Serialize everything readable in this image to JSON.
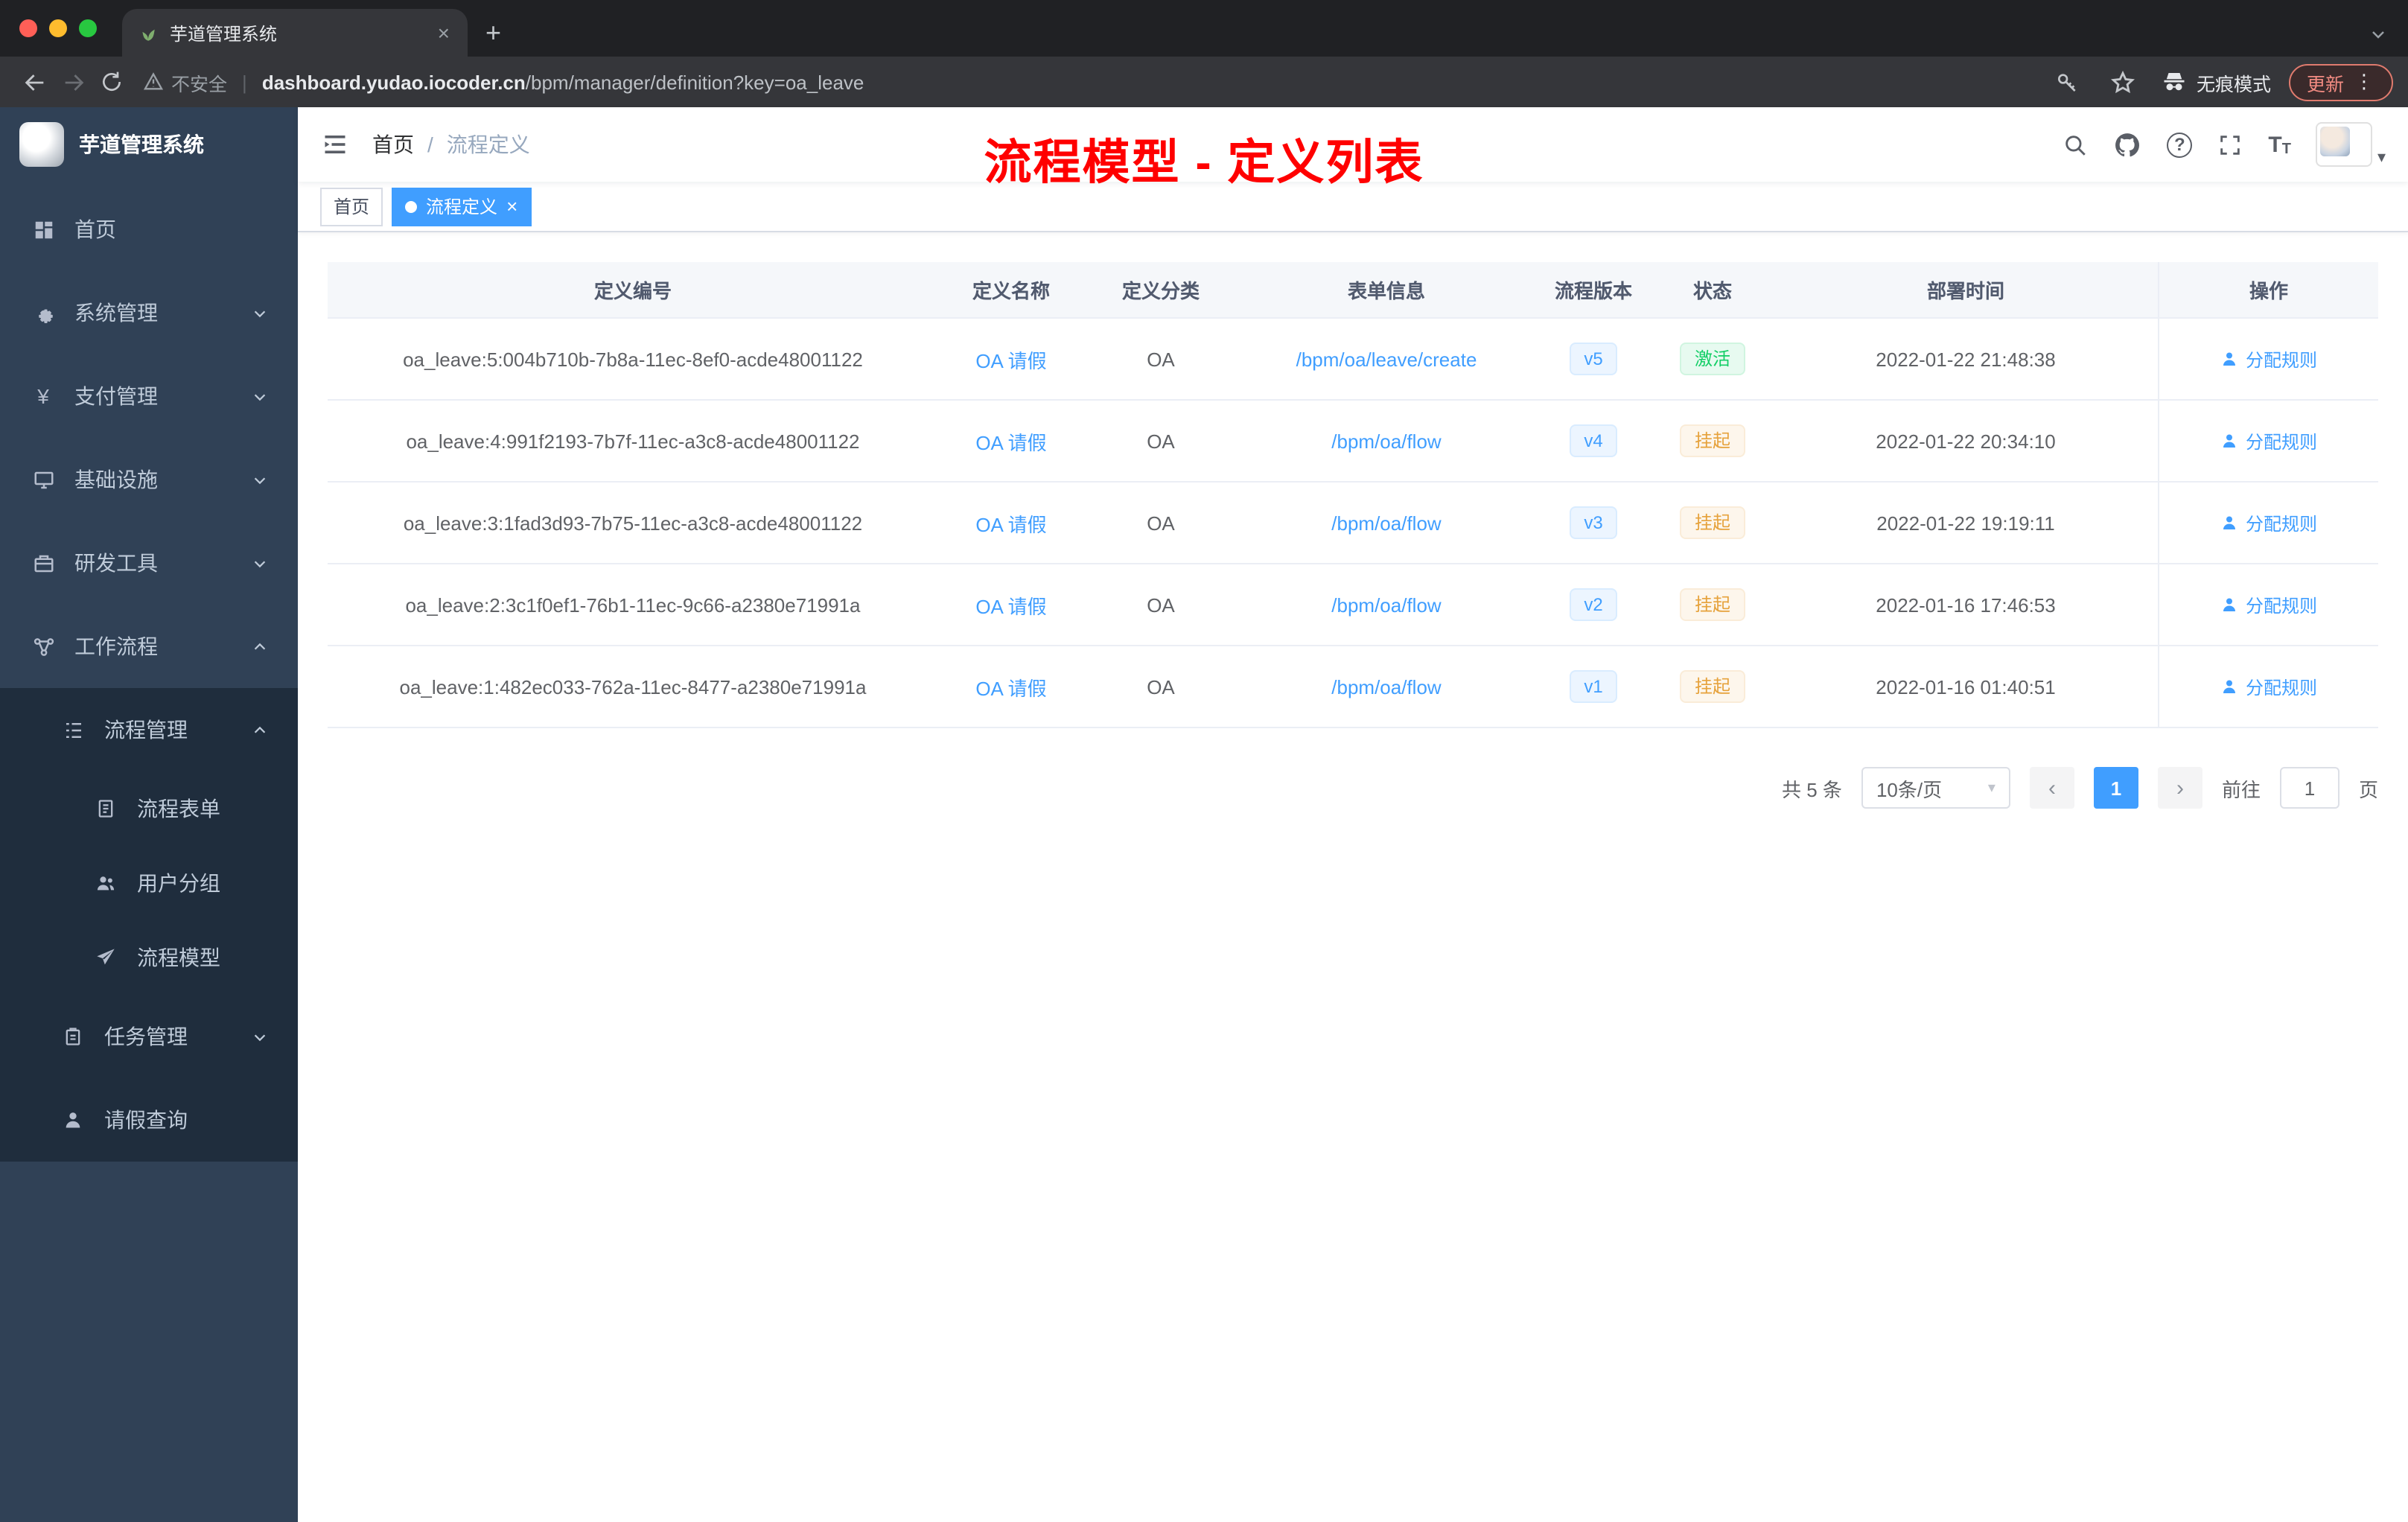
{
  "colors": {
    "accent": "#409eff",
    "success": "#13ce66",
    "warning": "#e6a23c",
    "annotation": "#ff0000",
    "sidebar_bg": "#304156",
    "submenu_bg": "#1f2d3d"
  },
  "browser": {
    "tab_title": "芋道管理系统",
    "security_label": "不安全",
    "url_domain": "dashboard.yudao.iocoder.cn",
    "url_path": "/bpm/manager/definition?key=oa_leave",
    "incognito_label": "无痕模式",
    "update_label": "更新"
  },
  "sidebar": {
    "brand": "芋道管理系统",
    "items": [
      {
        "label": "首页"
      },
      {
        "label": "系统管理"
      },
      {
        "label": "支付管理"
      },
      {
        "label": "基础设施"
      },
      {
        "label": "研发工具"
      },
      {
        "label": "工作流程"
      },
      {
        "label": "流程管理"
      },
      {
        "label": "流程表单"
      },
      {
        "label": "用户分组"
      },
      {
        "label": "流程模型"
      },
      {
        "label": "任务管理"
      },
      {
        "label": "请假查询"
      }
    ]
  },
  "header": {
    "breadcrumb": {
      "home": "首页",
      "current": "流程定义"
    },
    "annotation": "流程模型 - 定义列表"
  },
  "tags": {
    "home": "首页",
    "active": "流程定义"
  },
  "table": {
    "columns": {
      "id": "定义编号",
      "name": "定义名称",
      "category": "定义分类",
      "form": "表单信息",
      "version": "流程版本",
      "status": "状态",
      "time": "部署时间",
      "action": "操作"
    },
    "rows": [
      {
        "id": "oa_leave:5:004b710b-7b8a-11ec-8ef0-acde48001122",
        "name": "OA 请假",
        "category": "OA",
        "form": "/bpm/oa/leave/create",
        "version": "v5",
        "status": "激活",
        "status_type": "success",
        "time": "2022-01-22 21:48:38",
        "action": "分配规则"
      },
      {
        "id": "oa_leave:4:991f2193-7b7f-11ec-a3c8-acde48001122",
        "name": "OA 请假",
        "category": "OA",
        "form": "/bpm/oa/flow",
        "version": "v4",
        "status": "挂起",
        "status_type": "warning",
        "time": "2022-01-22 20:34:10",
        "action": "分配规则"
      },
      {
        "id": "oa_leave:3:1fad3d93-7b75-11ec-a3c8-acde48001122",
        "name": "OA 请假",
        "category": "OA",
        "form": "/bpm/oa/flow",
        "version": "v3",
        "status": "挂起",
        "status_type": "warning",
        "time": "2022-01-22 19:19:11",
        "action": "分配规则"
      },
      {
        "id": "oa_leave:2:3c1f0ef1-76b1-11ec-9c66-a2380e71991a",
        "name": "OA 请假",
        "category": "OA",
        "form": "/bpm/oa/flow",
        "version": "v2",
        "status": "挂起",
        "status_type": "warning",
        "time": "2022-01-16 17:46:53",
        "action": "分配规则"
      },
      {
        "id": "oa_leave:1:482ec033-762a-11ec-8477-a2380e71991a",
        "name": "OA 请假",
        "category": "OA",
        "form": "/bpm/oa/flow",
        "version": "v1",
        "status": "挂起",
        "status_type": "warning",
        "time": "2022-01-16 01:40:51",
        "action": "分配规则"
      }
    ]
  },
  "pagination": {
    "total": "共 5 条",
    "page_size": "10条/页",
    "page": "1",
    "goto": "前往",
    "goto_value": "1",
    "unit": "页"
  }
}
